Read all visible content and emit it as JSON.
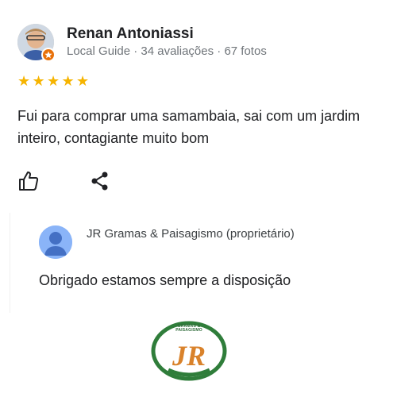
{
  "review": {
    "reviewer_name": "Renan Antoniassi",
    "reviewer_meta": "Local Guide · 34 avaliações · 67 fotos",
    "rating": 5,
    "stars": [
      "★",
      "★",
      "★",
      "★",
      "★"
    ],
    "text": "Fui para comprar uma samambaia, sai com um jardim inteiro, contagiante muito bom"
  },
  "actions": {
    "like_icon": "thumbs-up-icon",
    "share_icon": "share-icon"
  },
  "owner_reply": {
    "owner_name": "JR Gramas & Paisagismo (proprietário)",
    "text": "Obrigado estamos sempre a disposição"
  },
  "logo": {
    "line1": "GRAMAS &",
    "line2": "PAISAGISMO",
    "monogram": "JR"
  },
  "colors": {
    "star": "#f6b400",
    "guide_badge": "#e8710a",
    "owner_avatar": "#8ab4f8",
    "logo_green": "#2f7d3a",
    "logo_orange": "#d9822b"
  }
}
